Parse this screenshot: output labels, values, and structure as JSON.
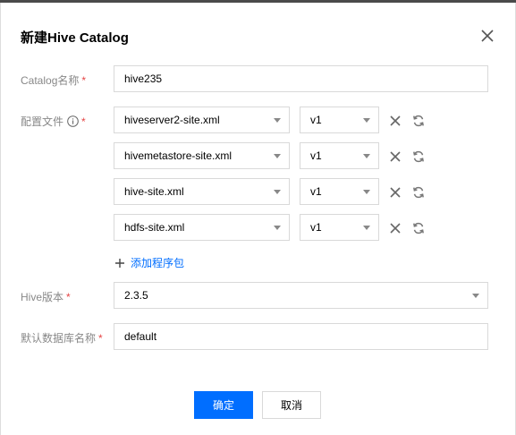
{
  "dialog": {
    "title": "新建Hive Catalog",
    "close_icon": "close-icon"
  },
  "form": {
    "catalog_name": {
      "label": "Catalog名称",
      "required_mark": "*",
      "value": "hive235"
    },
    "config_files": {
      "label": "配置文件",
      "required_mark": "*",
      "info_icon": "info-icon",
      "rows": [
        {
          "file": "hiveserver2-site.xml",
          "version": "v1"
        },
        {
          "file": "hivemetastore-site.xml",
          "version": "v1"
        },
        {
          "file": "hive-site.xml",
          "version": "v1"
        },
        {
          "file": "hdfs-site.xml",
          "version": "v1"
        }
      ],
      "delete_icon": "close-icon",
      "refresh_icon": "refresh-icon",
      "add_label": "添加程序包"
    },
    "hive_version": {
      "label": "Hive版本",
      "required_mark": "*",
      "value": "2.3.5"
    },
    "default_db": {
      "label": "默认数据库名称",
      "required_mark": "*",
      "value": "default"
    }
  },
  "footer": {
    "confirm_label": "确定",
    "cancel_label": "取消"
  },
  "colors": {
    "primary": "#006eff",
    "required": "#e54545",
    "label": "#888888",
    "border": "#d9d9d9"
  }
}
